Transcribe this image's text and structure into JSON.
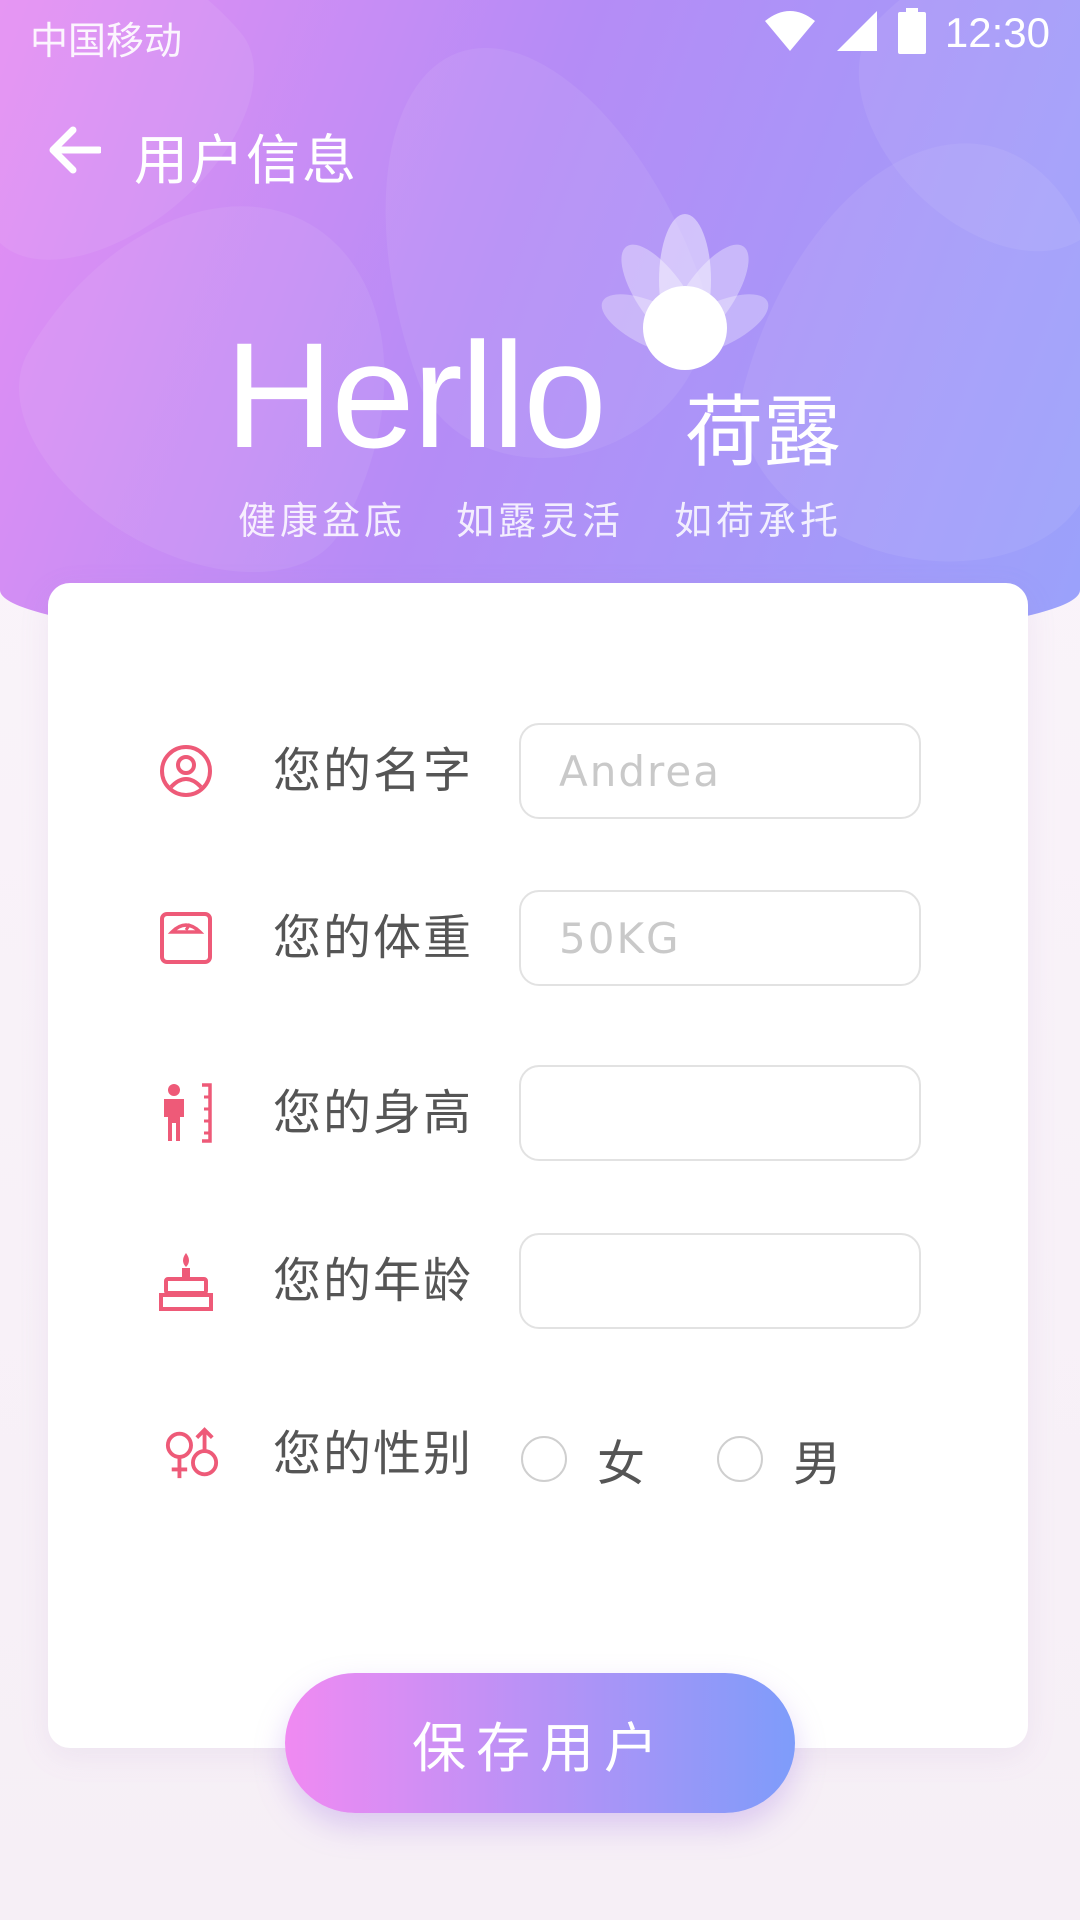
{
  "status_bar": {
    "carrier": "中国移动",
    "time": "12:30"
  },
  "nav": {
    "title": "用户信息"
  },
  "brand": {
    "logo_text": "Herllo",
    "logo_cn": "荷露",
    "slogans": [
      "健康盆底",
      "如露灵活",
      "如荷承托"
    ]
  },
  "form": {
    "name": {
      "label": "您的名字",
      "placeholder": "Andrea",
      "icon": "user-circle-icon"
    },
    "weight": {
      "label": "您的体重",
      "placeholder": "50KG",
      "icon": "scale-icon"
    },
    "height": {
      "label": "您的身高",
      "placeholder": "",
      "icon": "height-ruler-icon"
    },
    "age": {
      "label": "您的年龄",
      "placeholder": "",
      "icon": "cake-icon"
    },
    "gender": {
      "label": "您的性别",
      "icon": "gender-icon",
      "options": [
        "女",
        "男"
      ]
    }
  },
  "actions": {
    "save_label": "保存用户"
  },
  "colors": {
    "accent_icon": "#ee5a78",
    "gradient_start": "#f08af2",
    "gradient_end": "#7e9cfa"
  }
}
